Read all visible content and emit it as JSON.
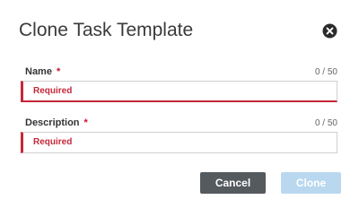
{
  "dialog": {
    "title": "Clone Task Template",
    "close_icon": "close-circle-icon"
  },
  "fields": {
    "name": {
      "label": "Name",
      "required_marker": "*",
      "counter": "0 / 50",
      "value": "",
      "error": "Required"
    },
    "description": {
      "label": "Description",
      "required_marker": "*",
      "counter": "0 / 50",
      "value": "",
      "error": "Required"
    }
  },
  "actions": {
    "cancel_label": "Cancel",
    "clone_label": "Clone"
  },
  "colors": {
    "error": "#c4283a",
    "cancel_bg": "#555a5f",
    "clone_bg_disabled": "#b9d8ef"
  }
}
